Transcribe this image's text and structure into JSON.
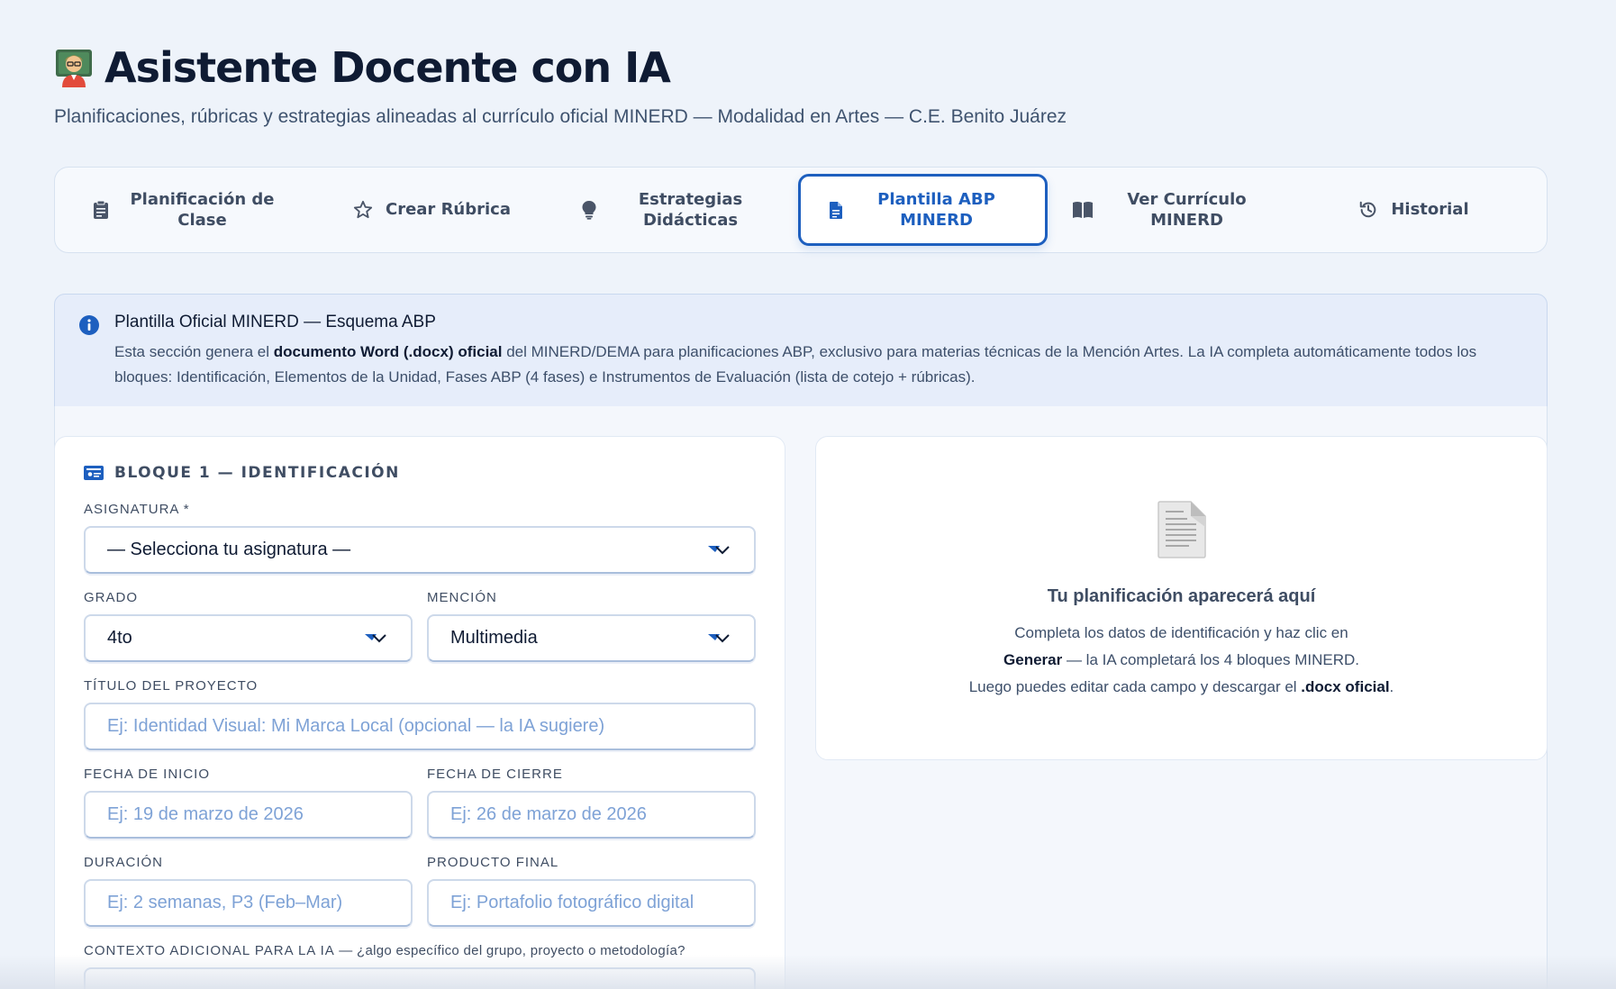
{
  "header": {
    "emoji_icon": "teacher-emoji-icon",
    "title": "Asistente Docente con IA",
    "subtitle": "Planificaciones, rúbricas y estrategias alineadas al currículo oficial MINERD — Modalidad en Artes — C.E. Benito Juárez"
  },
  "tabs": [
    {
      "label": "Planificación de Clase",
      "icon": "clipboard-icon",
      "active": false
    },
    {
      "label": "Crear Rúbrica",
      "icon": "star-icon",
      "active": false
    },
    {
      "label": "Estrategias Didácticas",
      "icon": "lightbulb-icon",
      "active": false
    },
    {
      "label": "Plantilla ABP MINERD",
      "icon": "document-icon",
      "active": true
    },
    {
      "label": "Ver Currículo MINERD",
      "icon": "book-icon",
      "active": false
    },
    {
      "label": "Historial",
      "icon": "history-icon",
      "active": false
    }
  ],
  "info": {
    "title": "Plantilla Oficial MINERD — Esquema ABP",
    "text_1": "Esta sección genera el ",
    "text_bold_1": "documento Word (.docx) oficial",
    "text_2": " del MINERD/DEMA para planificaciones ABP, exclusivo para materias técnicas de la Mención Artes. La IA completa automáticamente todos los bloques: Identificación, Elementos de la Unidad, Fases ABP (4 fases) e Instrumentos de Evaluación (lista de cotejo + rúbricas)."
  },
  "form": {
    "block_title": "BLOQUE 1 — IDENTIFICACIÓN",
    "asignatura": {
      "label": "ASIGNATURA *",
      "value": "— Selecciona tu asignatura —"
    },
    "grado": {
      "label": "GRADO",
      "value": "4to"
    },
    "mencion": {
      "label": "MENCIÓN",
      "value": "Multimedia"
    },
    "titulo": {
      "label": "TÍTULO DEL PROYECTO",
      "placeholder": "Ej: Identidad Visual: Mi Marca Local (opcional — la IA sugiere)"
    },
    "fecha_inicio": {
      "label": "FECHA DE INICIO",
      "placeholder": "Ej: 19 de marzo de 2026"
    },
    "fecha_cierre": {
      "label": "FECHA DE CIERRE",
      "placeholder": "Ej: 26 de marzo de 2026"
    },
    "duracion": {
      "label": "DURACIÓN",
      "placeholder": "Ej: 2 semanas, P3 (Feb–Mar)"
    },
    "producto": {
      "label": "PRODUCTO FINAL",
      "placeholder": "Ej: Portafolio fotográfico digital"
    },
    "contexto": {
      "label": "CONTEXTO ADICIONAL PARA LA IA",
      "hint": " — ¿algo específico del grupo, proyecto o metodología?"
    }
  },
  "preview": {
    "title": "Tu planificación aparecerá aquí",
    "line1": "Completa los datos de identificación y haz clic en",
    "line2_bold": "Generar",
    "line2": " — la IA completará los 4 bloques MINERD.",
    "line3": "Luego puedes editar cada campo y descargar el ",
    "line3_bold": ".docx oficial",
    "line3_end": "."
  },
  "colors": {
    "accent": "#1d5fbf",
    "background": "#eef3fa",
    "placeholder": "#7ea2d6"
  }
}
